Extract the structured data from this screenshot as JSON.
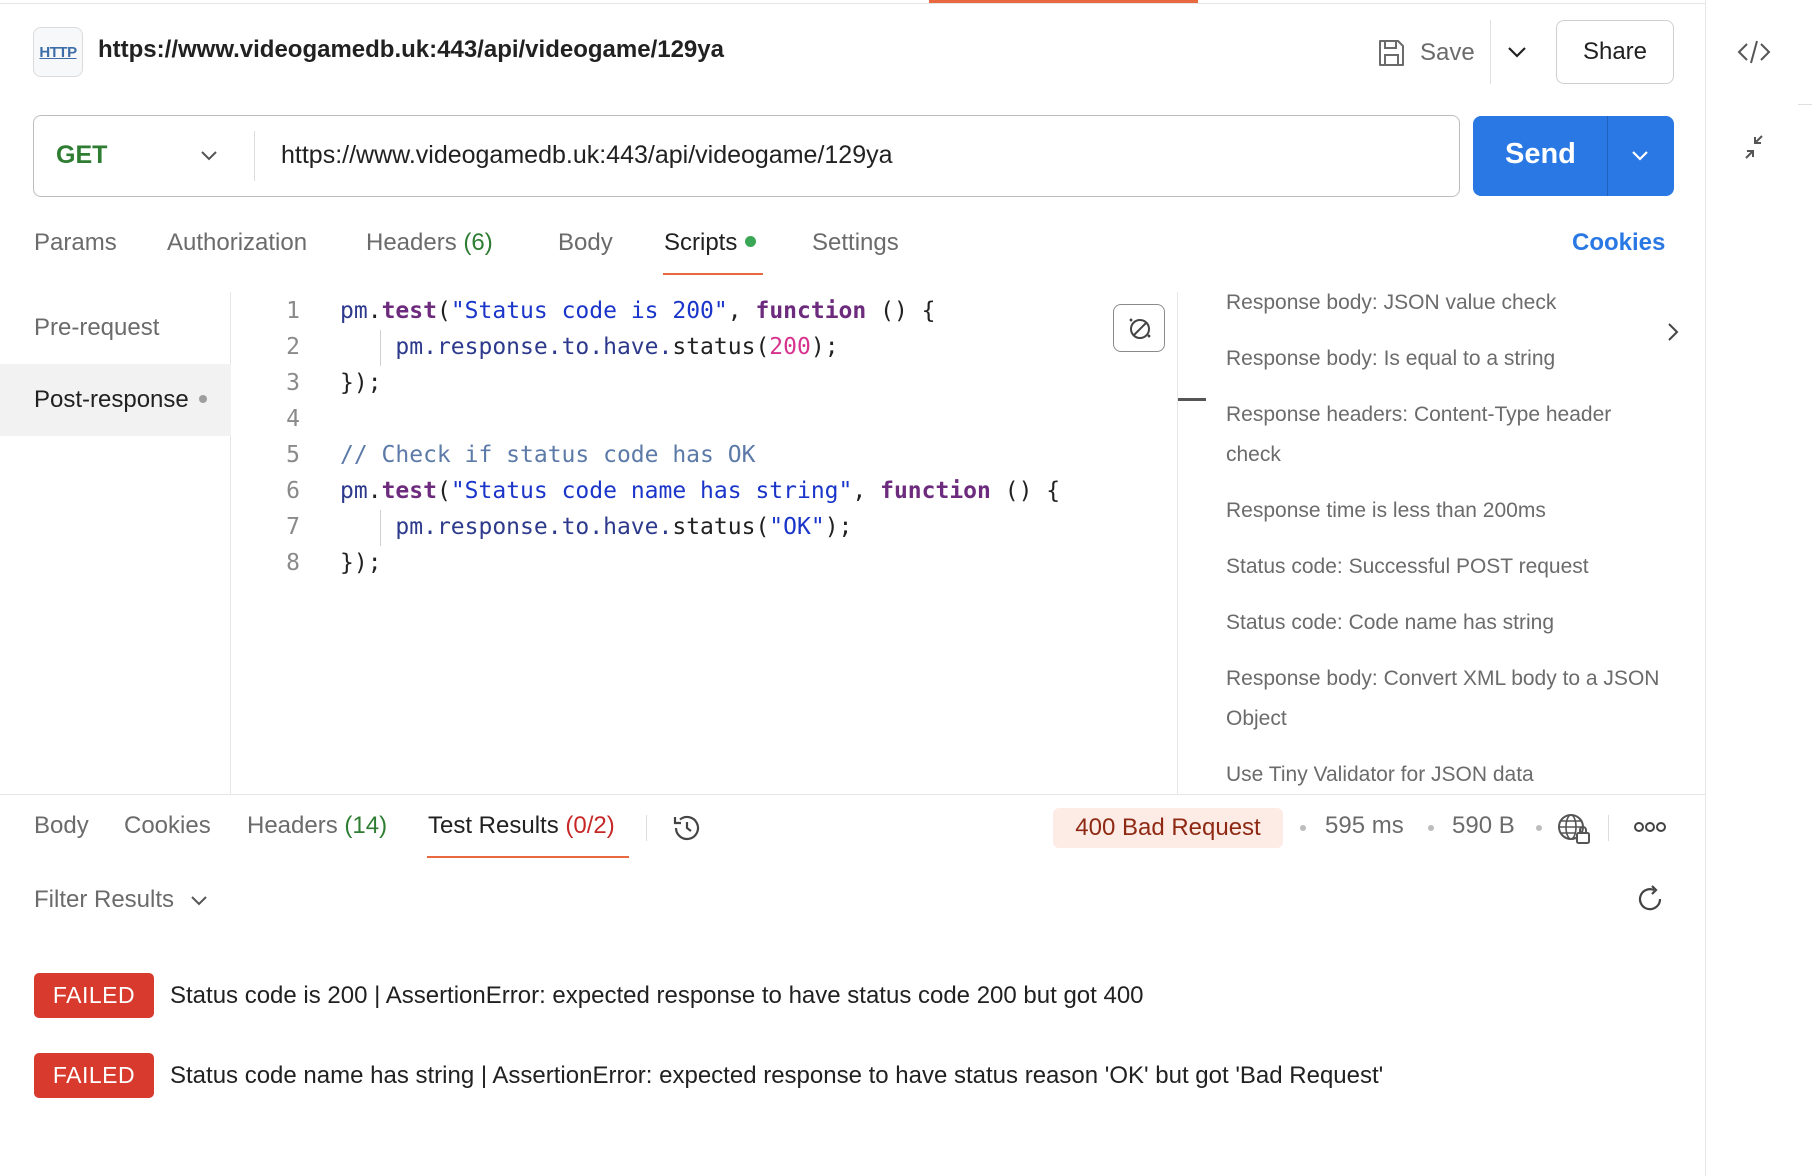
{
  "header": {
    "badge": "HTTP",
    "title": "https://www.videogamedb.uk:443/api/videogame/129ya",
    "save_label": "Save",
    "share_label": "Share"
  },
  "request": {
    "method": "GET",
    "url": "https://www.videogamedb.uk:443/api/videogame/129ya",
    "send_label": "Send"
  },
  "request_tabs": {
    "params": "Params",
    "authorization": "Authorization",
    "headers": "Headers",
    "headers_count": "(6)",
    "body": "Body",
    "scripts": "Scripts",
    "settings": "Settings",
    "cookies": "Cookies",
    "active": "Scripts"
  },
  "script_sidebar": {
    "pre_request": "Pre-request",
    "post_response": "Post-response",
    "active": "Post-response"
  },
  "code": {
    "line_numbers": [
      "1",
      "2",
      "3",
      "4",
      "5",
      "6",
      "7",
      "8"
    ],
    "line1": {
      "a": "pm",
      "b": ".",
      "c": "test",
      "d": "(",
      "e": "\"Status code is 200\"",
      "f": ", ",
      "g": "function",
      "h": " () {"
    },
    "line2": {
      "a": "pm",
      "b": ".response.to.have.",
      "c": "status",
      "d": "(",
      "e": "200",
      "f": ");"
    },
    "line3": "});",
    "line5": "// Check if status code has OK",
    "line6": {
      "a": "pm",
      "b": ".",
      "c": "test",
      "d": "(",
      "e": "\"Status code name has string\"",
      "f": ", ",
      "g": "function",
      "h": " () {"
    },
    "line7": {
      "a": "pm",
      "b": ".response.to.have.",
      "c": "status",
      "d": "(",
      "e": "\"OK\"",
      "f": ");"
    },
    "line8": "});"
  },
  "snippets": [
    "Response body: JSON value check",
    "Response body: Is equal to a string",
    "Response headers: Content-Type header check",
    "Response time is less than 200ms",
    "Status code: Successful POST request",
    "Status code: Code name has string",
    "Response body: Convert XML body to a JSON Object",
    "Use Tiny Validator for JSON data"
  ],
  "response_tabs": {
    "body": "Body",
    "cookies": "Cookies",
    "headers": "Headers",
    "headers_count": "(14)",
    "test_results": "Test Results",
    "test_results_count": "(0/2)",
    "active": "Test Results"
  },
  "response_meta": {
    "status": "400 Bad Request",
    "time": "595 ms",
    "size": "590 B"
  },
  "filter": {
    "label": "Filter Results"
  },
  "results": [
    {
      "status": "FAILED",
      "message": "Status code is 200 | AssertionError: expected response to have status code 200 but got 400"
    },
    {
      "status": "FAILED",
      "message": "Status code name has string | AssertionError: expected response to have status reason 'OK' but got 'Bad Request'"
    }
  ],
  "colors": {
    "accent": "#e8683f",
    "send": "#2a78e4",
    "failed": "#d83a2e",
    "method_get": "#2e7d32"
  },
  "icons": {
    "save": "save-icon",
    "code": "code-icon",
    "history": "history-icon",
    "globe": "globe-lock-icon",
    "more": "more-icon",
    "refresh": "refresh-icon",
    "beautify": "beautify-icon"
  }
}
